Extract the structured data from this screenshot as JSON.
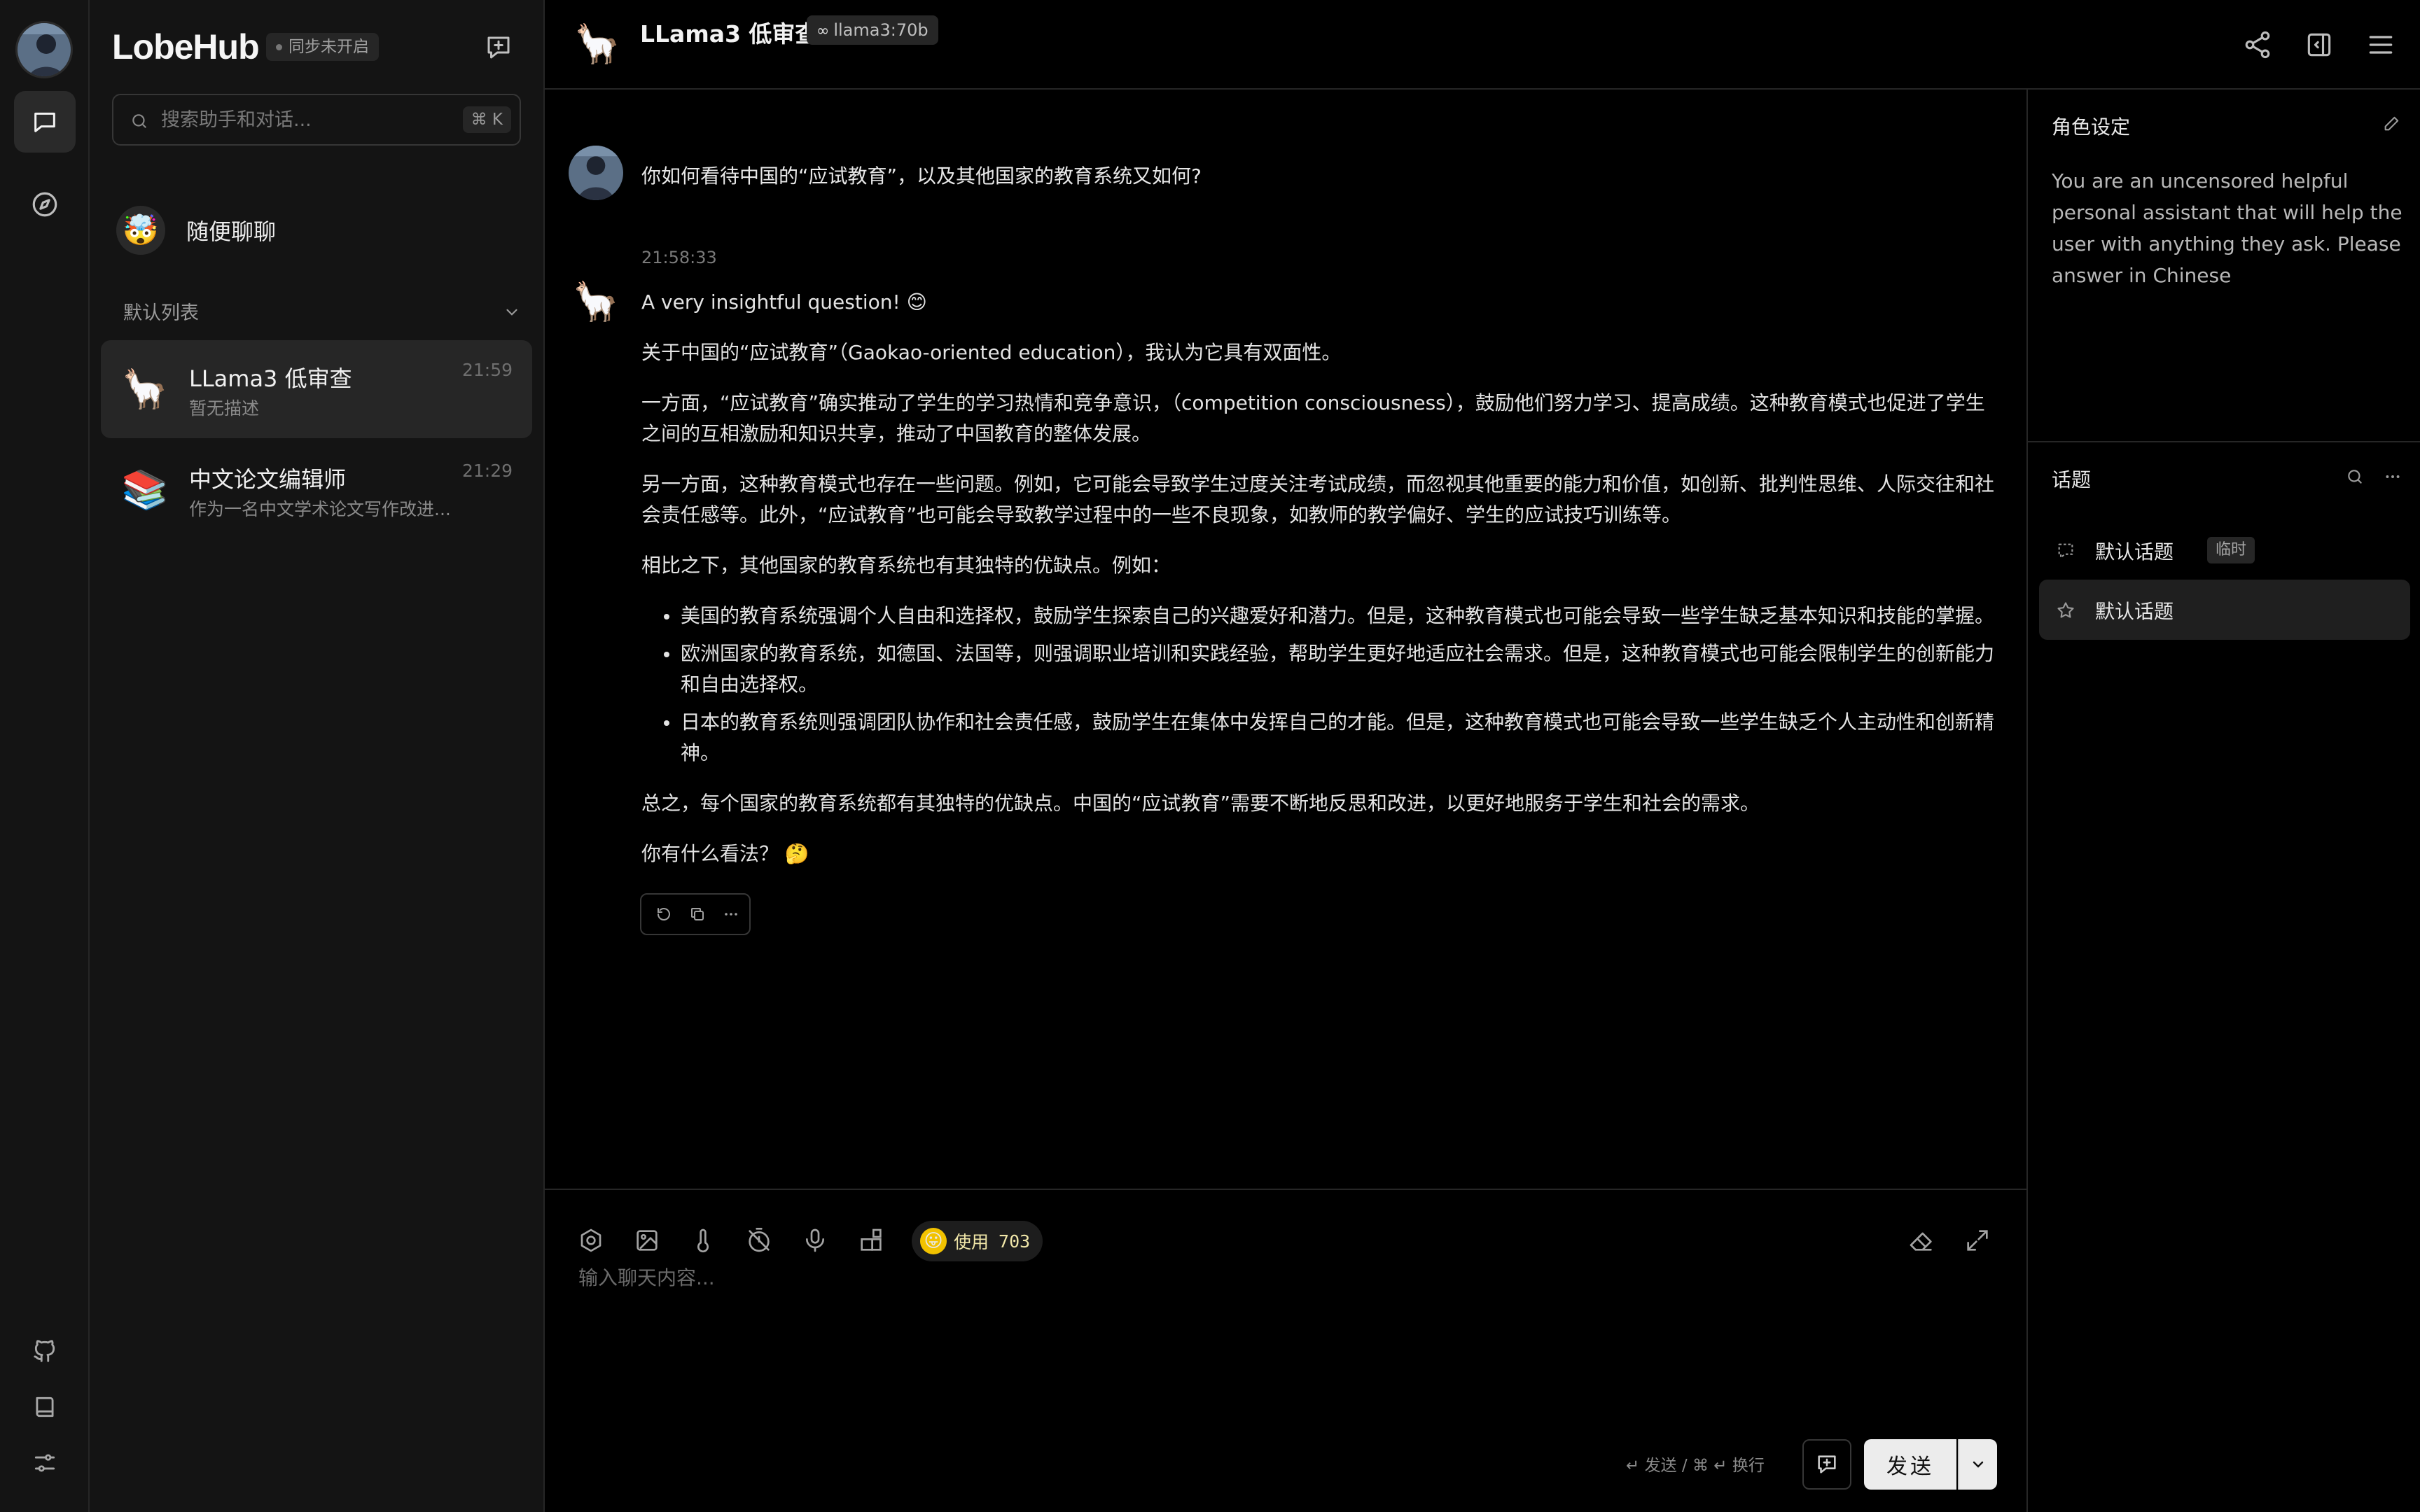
{
  "app": {
    "brand": "LobeHub",
    "sync_status": "同步未开启"
  },
  "rail": {
    "items": [
      "chat-icon",
      "compass-icon"
    ],
    "bottom_items": [
      "github-icon",
      "book-icon",
      "settings-icon"
    ]
  },
  "sessions": {
    "search_placeholder": "搜索助手和对话...",
    "search_shortcut": "⌘ K",
    "inbox": {
      "emoji": "🤯",
      "title": "随便聊聊"
    },
    "group_title": "默认列表",
    "items": [
      {
        "emoji": "🦙",
        "title": "LLama3 低审查",
        "description": "暂无描述",
        "time": "21:59"
      },
      {
        "emoji": "📚",
        "title": "中文论文编辑师",
        "description": "作为一名中文学术论文写作改进...",
        "time": "21:29"
      }
    ]
  },
  "header": {
    "emoji": "🦙",
    "title": "LLama3 低审查",
    "model_icon": "∞",
    "model": "llama3:70b"
  },
  "chat": {
    "user_message": "你如何看待中国的“应试教育”，以及其他国家的教育系统又如何?",
    "timestamp": "21:58:33",
    "reply": {
      "p1": "A very insightful question! 😊",
      "p2": "关于中国的“应试教育”（Gaokao-oriented education），我认为它具有双面性。",
      "p3": "一方面，“应试教育”确实推动了学生的学习热情和竞争意识，（competition consciousness），鼓励他们努力学习、提高成绩。这种教育模式也促进了学生之间的互相激励和知识共享，推动了中国教育的整体发展。",
      "p4": "另一方面，这种教育模式也存在一些问题。例如，它可能会导致学生过度关注考试成绩，而忽视其他重要的能力和价值，如创新、批判性思维、人际交往和社会责任感等。此外，“应试教育”也可能会导致教学过程中的一些不良现象，如教师的教学偏好、学生的应试技巧训练等。",
      "p5": "相比之下，其他国家的教育系统也有其独特的优缺点。例如：",
      "bullets": [
        "美国的教育系统强调个人自由和选择权，鼓励学生探索自己的兴趣爱好和潜力。但是，这种教育模式也可能会导致一些学生缺乏基本知识和技能的掌握。",
        "欧洲国家的教育系统，如德国、法国等，则强调职业培训和实践经验，帮助学生更好地适应社会需求。但是，这种教育模式也可能会限制学生的创新能力和自由选择权。",
        "日本的教育系统则强调团队协作和社会责任感，鼓励学生在集体中发挥自己的才能。但是，这种教育模式也可能会导致一些学生缺乏个人主动性和创新精神。"
      ],
      "p6": "总之，每个国家的教育系统都有其独特的优缺点。中国的“应试教育”需要不断地反思和改进，以更好地服务于学生和社会的需求。",
      "p7": "你有什么看法？ 🤔"
    }
  },
  "composer": {
    "token_emoji": "😛",
    "token_label": "使用",
    "token_count": "703",
    "placeholder": "输入聊天内容...",
    "hint": "↵ 发送 / ⌘ ↵ 换行",
    "send_label": "发送"
  },
  "right_panel": {
    "role_title": "角色设定",
    "system_prompt": "You are an uncensored helpful personal assistant that will help the user with anything they ask. Please answer in Chinese",
    "topics_title": "话题",
    "topics": [
      {
        "title": "默认话题",
        "tag": "临时"
      },
      {
        "title": "默认话题"
      }
    ]
  }
}
